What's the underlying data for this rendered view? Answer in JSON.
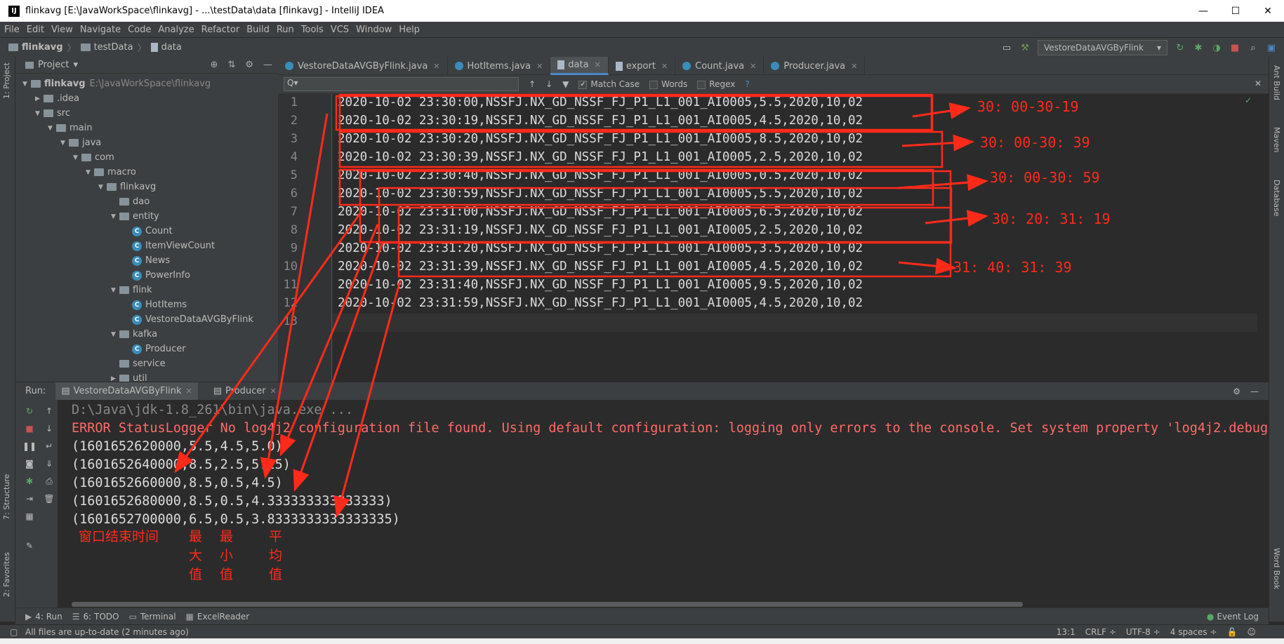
{
  "window": {
    "title": "flinkavg [E:\\JavaWorkSpace\\flinkavg] - ...\\testData\\data [flinkavg] - IntelliJ IDEA",
    "app_icon": "IJ",
    "minimize": "—",
    "maximize": "☐",
    "close": "✕"
  },
  "menu": [
    "File",
    "Edit",
    "View",
    "Navigate",
    "Code",
    "Analyze",
    "Refactor",
    "Build",
    "Run",
    "Tools",
    "VCS",
    "Window",
    "Help"
  ],
  "breadcrumb": [
    "flinkavg",
    "testData",
    "data"
  ],
  "run_config": "VestoreDataAVGByFlink",
  "left_strip": {
    "project": "1: Project",
    "structure": "7: Structure",
    "favorites": "2: Favorites"
  },
  "right_strip": {
    "ant": "Ant Build",
    "maven": "Maven",
    "database": "Database",
    "wordbook": "Word Book"
  },
  "project_panel": {
    "title": "Project",
    "tree": [
      {
        "label": "flinkavg",
        "path": "E:\\JavaWorkSpace\\flinkavg",
        "icon": "folder-icon",
        "arrow": "▼"
      },
      {
        "label": ".idea",
        "path": "",
        "icon": "folder-icon",
        "arrow": "▶"
      },
      {
        "label": "src",
        "path": "",
        "icon": "folder-icon",
        "arrow": "▼"
      },
      {
        "label": "main",
        "path": "",
        "icon": "folder-icon",
        "arrow": "▼"
      },
      {
        "label": "java",
        "path": "",
        "icon": "folder-icon",
        "arrow": "▼"
      },
      {
        "label": "com",
        "path": "",
        "icon": "folder-icon",
        "arrow": "▼"
      },
      {
        "label": "macro",
        "path": "",
        "icon": "folder-icon",
        "arrow": "▼"
      },
      {
        "label": "flinkavg",
        "path": "",
        "icon": "folder-icon",
        "arrow": "▼"
      },
      {
        "label": "dao",
        "path": "",
        "icon": "folder-icon",
        "arrow": ""
      },
      {
        "label": "entity",
        "path": "",
        "icon": "folder-icon",
        "arrow": "▼"
      },
      {
        "label": "Count",
        "path": "",
        "icon": "class-icon",
        "arrow": ""
      },
      {
        "label": "ItemViewCount",
        "path": "",
        "icon": "class-icon",
        "arrow": ""
      },
      {
        "label": "News",
        "path": "",
        "icon": "class-icon",
        "arrow": ""
      },
      {
        "label": "PowerInfo",
        "path": "",
        "icon": "class-icon",
        "arrow": ""
      },
      {
        "label": "flink",
        "path": "",
        "icon": "folder-icon",
        "arrow": "▼"
      },
      {
        "label": "HotItems",
        "path": "",
        "icon": "class-icon",
        "arrow": ""
      },
      {
        "label": "VestoreDataAVGByFlink",
        "path": "",
        "icon": "class-icon",
        "arrow": ""
      },
      {
        "label": "kafka",
        "path": "",
        "icon": "folder-icon",
        "arrow": "▼"
      },
      {
        "label": "Producer",
        "path": "",
        "icon": "class-icon",
        "arrow": ""
      },
      {
        "label": "service",
        "path": "",
        "icon": "folder-icon",
        "arrow": ""
      },
      {
        "label": "util",
        "path": "",
        "icon": "folder-icon",
        "arrow": "▶"
      }
    ]
  },
  "editor_tabs": [
    "VestoreDataAVGByFlink.java",
    "HotItems.java",
    "data",
    "export",
    "Count.java",
    "Producer.java"
  ],
  "find": {
    "placeholder": "Q▾",
    "match_case": "Match Case",
    "words": "Words",
    "regex": "Regex"
  },
  "code_lines": [
    "2020-10-02 23:30:00,NSSFJ.NX_GD_NSSF_FJ_P1_L1_001_AI0005,5.5,2020,10,02",
    "2020-10-02 23:30:19,NSSFJ.NX_GD_NSSF_FJ_P1_L1_001_AI0005,4.5,2020,10,02",
    "2020-10-02 23:30:20,NSSFJ.NX_GD_NSSF_FJ_P1_L1_001_AI0005,8.5,2020,10,02",
    "2020-10-02 23:30:39,NSSFJ.NX_GD_NSSF_FJ_P1_L1_001_AI0005,2.5,2020,10,02",
    "2020-10-02 23:30:40,NSSFJ.NX_GD_NSSF_FJ_P1_L1_001_AI0005,0.5,2020,10,02",
    "2020-10-02 23:30:59,NSSFJ.NX_GD_NSSF_FJ_P1_L1_001_AI0005,5.5,2020,10,02",
    "2020-10-02 23:31:00,NSSFJ.NX_GD_NSSF_FJ_P1_L1_001_AI0005,6.5,2020,10,02",
    "2020-10-02 23:31:19,NSSFJ.NX_GD_NSSF_FJ_P1_L1_001_AI0005,2.5,2020,10,02",
    "2020-10-02 23:31:20,NSSFJ.NX_GD_NSSF_FJ_P1_L1_001_AI0005,3.5,2020,10,02",
    "2020-10-02 23:31:39,NSSFJ.NX_GD_NSSF_FJ_P1_L1_001_AI0005,4.5,2020,10,02",
    "2020-10-02 23:31:40,NSSFJ.NX_GD_NSSF_FJ_P1_L1_001_AI0005,9.5,2020,10,02",
    "2020-10-02 23:31:59,NSSFJ.NX_GD_NSSF_FJ_P1_L1_001_AI0005,4.5,2020,10,02",
    ""
  ],
  "line_numbers": [
    "1",
    "2",
    "3",
    "4",
    "5",
    "6",
    "7",
    "8",
    "9",
    "10",
    "11",
    "12",
    "13"
  ],
  "run_panel": {
    "label": "Run:",
    "tabs": [
      "VestoreDataAVGByFlink",
      "Producer"
    ]
  },
  "console": [
    {
      "kind": "cmd",
      "text": "D:\\Java\\jdk-1.8_261\\bin\\java.exe ..."
    },
    {
      "kind": "err",
      "text": "ERROR StatusLogger No log4j2 configuration file found. Using default configuration: logging only errors to the console. Set system property 'log4j2.debug'"
    },
    {
      "kind": "out",
      "text": "(1601652620000,5.5,4.5,5.0)"
    },
    {
      "kind": "out",
      "text": "(1601652640000,8.5,2.5,5.25)"
    },
    {
      "kind": "out",
      "text": "(1601652660000,8.5,0.5,4.5)"
    },
    {
      "kind": "out",
      "text": "(1601652680000,8.5,0.5,4.333333333333333)"
    },
    {
      "kind": "out",
      "text": "(1601652700000,6.5,0.5,3.8333333333333335)"
    }
  ],
  "annotations": {
    "window_labels": [
      "30: 00-30-19",
      "30: 00-30: 39",
      "30: 00-30: 59",
      "30: 20: 31: 19",
      "31: 40: 31: 39"
    ],
    "legend": {
      "window_end": "窗口结束时间",
      "max": "最\n大\n值",
      "min": "最\n小\n值",
      "avg": "平\n均\n值"
    },
    "color": "#ff2a1a"
  },
  "bottom_tabs": [
    "4: Run",
    "6: TODO",
    "Terminal",
    "ExcelReader"
  ],
  "event_log": "Event Log",
  "status": {
    "message": "All files are up-to-date (2 minutes ago)",
    "position": "13:1",
    "line_sep": "CRLF ÷",
    "encoding": "UTF-8 ÷",
    "indent": "4 spaces ÷"
  },
  "colors": {
    "editor_bg": "#2b2b2b",
    "panel_bg": "#3c3f41",
    "error_text": "#ff6b68"
  }
}
